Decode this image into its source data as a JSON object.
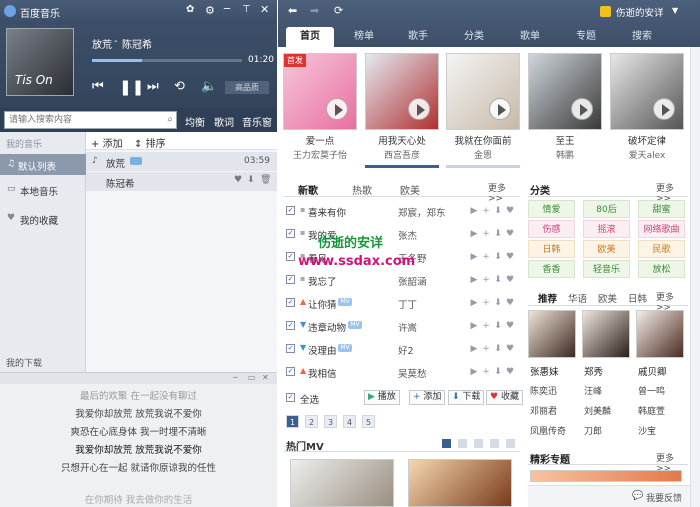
{
  "app": {
    "title": "百度音乐"
  },
  "player": {
    "track_title": "放荒",
    "track_sep": "-",
    "track_artist": "陈冠希",
    "time": "01:20",
    "quality_label": "高品质",
    "album_text": "Tis On"
  },
  "search": {
    "placeholder": "请输入搜索内容",
    "buttons": [
      "均衡",
      "歌词",
      "音乐窗"
    ]
  },
  "sidebar": {
    "header": "我的音乐",
    "items": [
      "默认列表",
      "本地音乐",
      "我的收藏"
    ],
    "download": "我的下载"
  },
  "playlist_tools": {
    "add": "添加",
    "sort": "排序"
  },
  "playlist": [
    {
      "title": "放荒",
      "duration": "03:59"
    },
    {
      "title": "陈冠希",
      "duration": ""
    }
  ],
  "lyrics": {
    "header": "最后的欢聚 在一起没有聊过",
    "lines": [
      "我爱你却放荒 放荒我说不爱你",
      "爽恐在心底身体 我一时埋不清晰",
      "我爱你却放荒 放荒我说不爱你",
      "只想开心在一起 就请你原谅我的任性",
      "在你期待 我去做你的生活"
    ]
  },
  "nav": {
    "user": "伤逝的安详",
    "tabs": [
      "首页",
      "榜单",
      "歌手",
      "分类",
      "歌单",
      "专题",
      "搜索"
    ]
  },
  "banner": [
    {
      "title": "爱一点",
      "subtitle": "王力宏莫子怡",
      "badge": "首发"
    },
    {
      "title": "用我天心处",
      "subtitle": "西宫吾彦"
    },
    {
      "title": "我就在你面前",
      "subtitle": "金恩"
    },
    {
      "title": "至王",
      "subtitle": "韩鹏"
    },
    {
      "title": "破坏定律",
      "subtitle": "爱天alex"
    }
  ],
  "song_tabs": [
    "新歌",
    "热歌",
    "欧美"
  ],
  "more_label": "更多>>",
  "songs": [
    {
      "title": "喜来有你",
      "artist": "郑宸，郑东"
    },
    {
      "title": "我的爱",
      "artist": "张杰"
    },
    {
      "title": "看见",
      "artist": "于冬野"
    },
    {
      "title": "我忘了",
      "artist": "张韶涵"
    },
    {
      "title": "让你猜",
      "artist": "丁丁"
    },
    {
      "title": "违章动物",
      "artist": "许嵩"
    },
    {
      "title": "没理由",
      "artist": "好2"
    },
    {
      "title": "我相信",
      "artist": "吴莫愁"
    }
  ],
  "mv_badge": "MV",
  "select_all": "全选",
  "song_actions": [
    "播放",
    "添加",
    "下载",
    "收藏"
  ],
  "pages": [
    "1",
    "2",
    "3",
    "4",
    "5"
  ],
  "watermark": {
    "line1": "伤逝的安详",
    "line2": "www.ssdax.com"
  },
  "category": {
    "title": "分类",
    "items": [
      "情爱",
      "80后",
      "甜蜜",
      "伤感",
      "摇滚",
      "网络歌曲",
      "日韩",
      "欧美",
      "民歌",
      "香香",
      "轻音乐",
      "放松"
    ]
  },
  "recommend": {
    "tabs": [
      "推荐",
      "华语",
      "欧美",
      "日韩"
    ],
    "stars": [
      "张惠妹",
      "郑秀",
      "戚贝卿"
    ],
    "names": [
      [
        "陈奕迅",
        "汪峰",
        "曾一鸣"
      ],
      [
        "邓丽君",
        "刘美麟",
        "韩庭萱"
      ],
      [
        "凤凰传奇",
        "刀郎",
        "沙宝"
      ]
    ]
  },
  "hot_mv": {
    "title": "热门MV"
  },
  "special": {
    "title": "精彩专题"
  },
  "feedback": "我要反馈",
  "colors": {
    "accent": "#2f5fb3",
    "tab_active": "#ffffff",
    "red": "#d33"
  }
}
